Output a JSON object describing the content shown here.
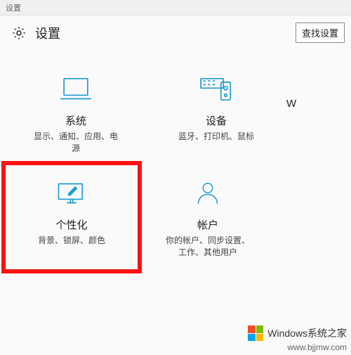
{
  "window": {
    "title": "设置"
  },
  "header": {
    "title": "设置",
    "search_label": "查找设置"
  },
  "tiles": {
    "system": {
      "title": "系统",
      "desc": "显示、通知、应用、电\n源"
    },
    "devices": {
      "title": "设备",
      "desc": "蓝牙、打印机、鼠标"
    },
    "personalize": {
      "title": "个性化",
      "desc": "背景、锁屏、颜色"
    },
    "accounts": {
      "title": "帐户",
      "desc": "你的帐户、同步设置、\n工作、其他用户"
    }
  },
  "extra_letter": "W",
  "watermark": {
    "brand": "Windows系统之家",
    "url": "www.bjjmw.com"
  }
}
